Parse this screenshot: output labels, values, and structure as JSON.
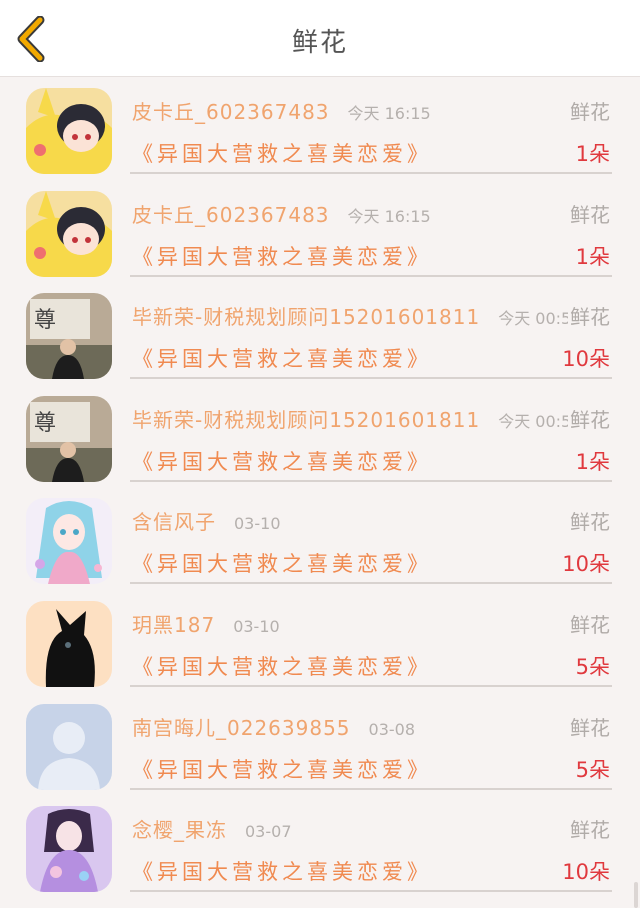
{
  "header": {
    "title": "鲜花",
    "back_icon": "chevron-left-icon",
    "accent": "#f2a900"
  },
  "colors": {
    "name": "#f0a46e",
    "book": "#f08a50",
    "amount": "#e0393e",
    "meta": "#b5b0ad"
  },
  "items": [
    {
      "user": "皮卡丘_602367483",
      "time": "今天 16:15",
      "category": "鲜花",
      "book": "《异国大营救之喜美恋爱》",
      "amount": "1朵",
      "avatar": "pikachu-costume-avatar"
    },
    {
      "user": "皮卡丘_602367483",
      "time": "今天 16:15",
      "category": "鲜花",
      "book": "《异国大营救之喜美恋爱》",
      "amount": "1朵",
      "avatar": "pikachu-costume-avatar"
    },
    {
      "user": "毕新荣-财税规划顾问15201601811",
      "time": "今天 00:5",
      "category": "鲜花",
      "book": "《异国大营救之喜美恋爱》",
      "amount": "10朵",
      "avatar": "man-photo-avatar"
    },
    {
      "user": "毕新荣-财税规划顾问15201601811",
      "time": "今天 00:5",
      "category": "鲜花",
      "book": "《异国大营救之喜美恋爱》",
      "amount": "1朵",
      "avatar": "man-photo-avatar"
    },
    {
      "user": "含信风子",
      "time": "03-10",
      "category": "鲜花",
      "book": "《异国大营救之喜美恋爱》",
      "amount": "10朵",
      "avatar": "anime-girl-avatar"
    },
    {
      "user": "玥黑187",
      "time": "03-10",
      "category": "鲜花",
      "book": "《异国大营救之喜美恋爱》",
      "amount": "5朵",
      "avatar": "black-cat-avatar"
    },
    {
      "user": "南宫晦儿_022639855",
      "time": "03-08",
      "category": "鲜花",
      "book": "《异国大营救之喜美恋爱》",
      "amount": "5朵",
      "avatar": "default-user-avatar"
    },
    {
      "user": "念樱_果冻",
      "time": "03-07",
      "category": "鲜花",
      "book": "《异国大营救之喜美恋爱》",
      "amount": "10朵",
      "avatar": "anime-doll-avatar"
    }
  ]
}
